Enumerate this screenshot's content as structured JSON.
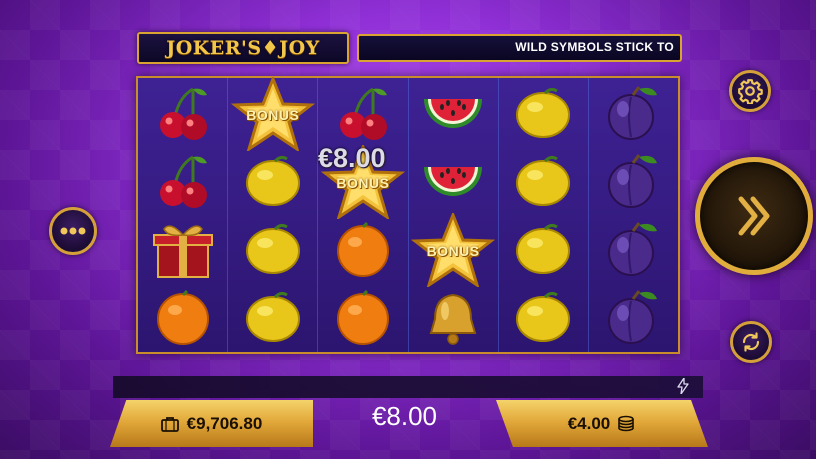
{
  "game": {
    "logo": "JOKER'S♦JOY",
    "ticker": "WILD SYMBOLS STICK TO"
  },
  "reels": [
    [
      "cherry",
      "cherry",
      "gift",
      "orange"
    ],
    [
      "star-bonus",
      "lemon",
      "lemon",
      "lemon"
    ],
    [
      "cherry",
      "star-bonus",
      "orange",
      "orange"
    ],
    [
      "watermelon",
      "watermelon",
      "star-bonus",
      "bell"
    ],
    [
      "lemon",
      "lemon",
      "lemon",
      "lemon"
    ],
    [
      "plum",
      "plum",
      "plum",
      "plum"
    ]
  ],
  "bonus_label": "BONUS",
  "win_amount": "€8.00",
  "bottom": {
    "balance": "€9,706.80",
    "total_win": "€8.00",
    "bet": "€4.00"
  },
  "colors": {
    "gold": "#d9a431",
    "background": "#8f2fd6",
    "reel_bg": "#3e2294"
  },
  "icons": {
    "settings": "gear-icon",
    "menu": "more-dots-icon",
    "spin": "double-chevron-right-icon",
    "autoplay": "refresh-icon",
    "turbo": "lightning-icon",
    "balance": "briefcase-icon",
    "bet": "coin-stack-icon"
  }
}
